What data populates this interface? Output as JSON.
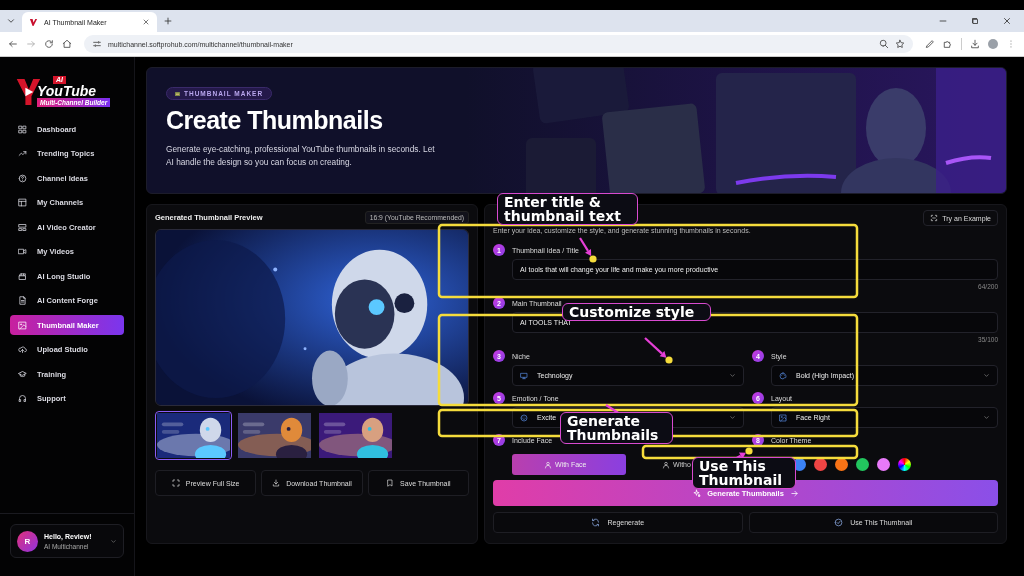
{
  "browser": {
    "tab_title": "AI Thumbnail Maker",
    "url": "multichannel.softprohub.com/multichannel/thumbnail-maker"
  },
  "sidebar": {
    "logo": {
      "badge": "AI",
      "title": "YouTube",
      "subtitle": "Multi-Channel Builder"
    },
    "items": [
      {
        "label": "Dashboard",
        "selected": false
      },
      {
        "label": "Trending Topics",
        "selected": false
      },
      {
        "label": "Channel Ideas",
        "selected": false
      },
      {
        "label": "My Channels",
        "selected": false
      },
      {
        "label": "AI Video Creator",
        "selected": false
      },
      {
        "label": "My Videos",
        "selected": false
      },
      {
        "label": "AI Long Studio",
        "selected": false
      },
      {
        "label": "AI Content Forge",
        "selected": false
      },
      {
        "label": "Thumbnail Maker",
        "selected": true
      },
      {
        "label": "Upload Studio",
        "selected": false
      },
      {
        "label": "Training",
        "selected": false
      },
      {
        "label": "Support",
        "selected": false
      }
    ],
    "user": {
      "initial": "R",
      "greeting": "Hello, Review!",
      "subtitle": "AI Multichannel"
    }
  },
  "hero": {
    "badge": "THUMBNAIL MAKER",
    "title": "Create Thumbnails",
    "description": "Generate eye-catching, professional YouTube thumbnails in seconds. Let AI handle the design so you can focus on creating."
  },
  "preview": {
    "title": "Generated Thumbnail Preview",
    "ratio": "16:9 (YouTube Recommended)",
    "thumbnails": [
      {
        "selected": true
      },
      {
        "selected": false
      },
      {
        "selected": false
      }
    ],
    "actions": [
      {
        "label": "Preview Full Size"
      },
      {
        "label": "Download Thumbnail"
      },
      {
        "label": "Save Thumbnail"
      }
    ]
  },
  "form": {
    "subtitle": "Enter your idea, customize the style, and generate stunning thumbnails in seconds.",
    "example_button": "Try an Example",
    "steps": [
      {
        "number": "1",
        "label": "Thumbnail Idea / Title",
        "kind": "text",
        "value": "AI tools that will change your life and make you more productive",
        "counter": "64/200"
      },
      {
        "number": "2",
        "label": "Main Thumbnail",
        "kind": "text",
        "value": "AI TOOLS THAT",
        "counter": "35/100"
      },
      {
        "number": "3",
        "label": "Niche",
        "kind": "select",
        "value": "Technology"
      },
      {
        "number": "4",
        "label": "Style",
        "kind": "select",
        "value": "Bold (High Impact)"
      },
      {
        "number": "5",
        "label": "Emotion / Tone",
        "kind": "select",
        "value": "Excite"
      },
      {
        "number": "6",
        "label": "Layout",
        "kind": "select",
        "value": "Face Right"
      },
      {
        "number": "7",
        "label": "Include Face",
        "kind": "toggle",
        "options": [
          {
            "label": "With Face",
            "selected": true
          },
          {
            "label": "Witho",
            "selected": false
          }
        ]
      },
      {
        "number": "8",
        "label": "Color Theme",
        "kind": "colors",
        "colors": [
          {
            "kind": "solid",
            "color": "#3b82f6"
          },
          {
            "kind": "solid",
            "color": "#ef4444"
          },
          {
            "kind": "solid",
            "color": "#f97316"
          },
          {
            "kind": "solid",
            "color": "#22c55e"
          },
          {
            "kind": "solid",
            "color": "#e879f9"
          },
          {
            "kind": "custom"
          }
        ]
      }
    ],
    "generate_button": "Generate Thumbnails",
    "regenerate_button": "Regenerate",
    "use_button": "Use This Thumbnail"
  },
  "annotations": [
    {
      "text": "Enter title & thumbnail text"
    },
    {
      "text": "Customize style"
    },
    {
      "text": "Generate Thumbnails"
    },
    {
      "text": "Use This Thumbnail"
    }
  ]
}
